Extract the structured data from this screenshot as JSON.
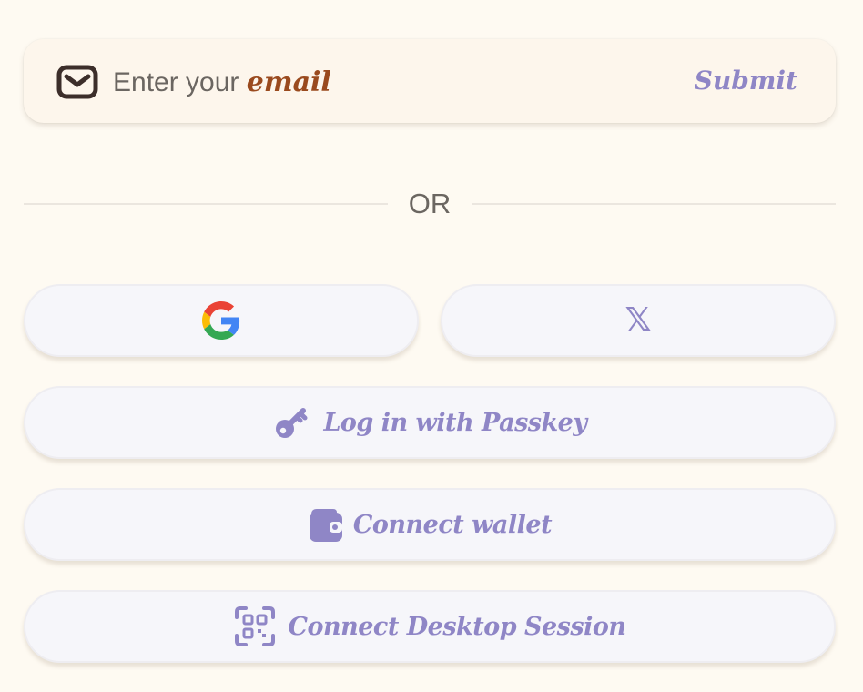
{
  "email": {
    "placeholder_prefix": "Enter your ",
    "placeholder_emphasis": "email",
    "submit_label": "Submit"
  },
  "divider": {
    "label": "OR"
  },
  "social": {
    "google_icon": "google-icon",
    "x_icon": "x-icon",
    "x_glyph": "𝕏"
  },
  "actions": {
    "passkey_label": "Log in with Passkey",
    "wallet_label": "Connect wallet",
    "desktop_label": "Connect Desktop Session"
  },
  "colors": {
    "background": "#fefaf2",
    "accent": "#8f86c6",
    "email_emphasis": "#9a4a1e",
    "muted_text": "#6b6661"
  }
}
